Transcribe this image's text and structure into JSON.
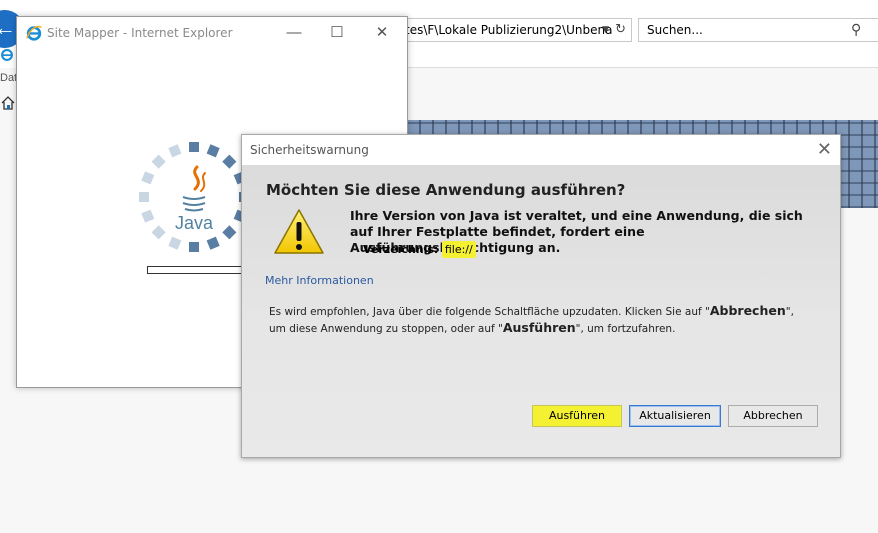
{
  "browser": {
    "address_text": "tes\\F\\Lokale Publizierung2\\Unbena",
    "search_placeholder": "Suchen...",
    "menu_fragment": "Dat"
  },
  "site_mapper": {
    "title": "Site Mapper - Internet Explorer",
    "minimize": "—",
    "maximize": "☐",
    "close": "✕",
    "java_word": "Java"
  },
  "dialog": {
    "title": "Sicherheitswarnung",
    "close": "✕",
    "heading": "Möchten Sie diese Anwendung ausführen?",
    "message": "Ihre Version von Java ist veraltet, und eine Anwendung, die sich auf Ihrer Festplatte befindet, fordert eine Ausführungsberechtigung an.",
    "directory_label": "Verzeichnis:",
    "directory_value": "file://",
    "more_info": "Mehr Informationen",
    "body_1": "Es wird empfohlen, Java über die folgende Schaltfläche upzudaten. Klicken Sie auf \"",
    "body_abbrechen": "Abbrechen",
    "body_2": "\", um diese Anwendung zu stoppen, oder auf \"",
    "body_ausfuehren": "Ausführen",
    "body_3": "\", um fortzufahren.",
    "buttons": {
      "run": "Ausführen",
      "update": "Aktualisieren",
      "cancel": "Abbrechen"
    }
  },
  "colors": {
    "highlight": "#f4f032",
    "java_blue": "#5382a1",
    "java_orange": "#e76f00",
    "warning_yellow": "#f7d21c"
  }
}
